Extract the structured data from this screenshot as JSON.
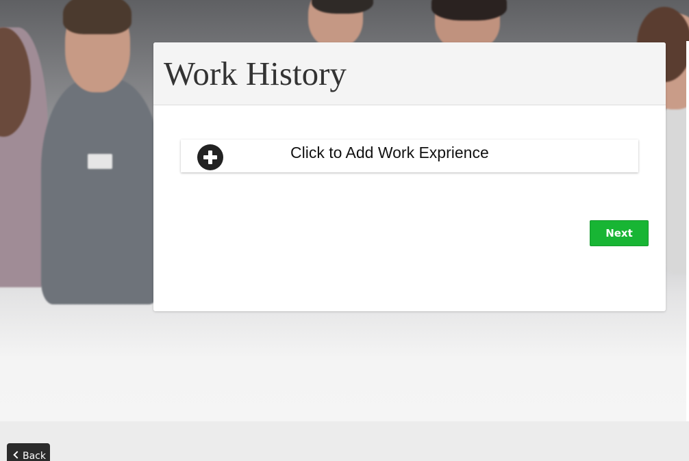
{
  "page": {
    "title": "Work History"
  },
  "work_history": {
    "add_label": "Click to Add Work Exprience",
    "add_icon": "plus-circle-icon"
  },
  "actions": {
    "next_label": "Next",
    "next_color": "#18b534",
    "back_label": "Back",
    "back_icon": "chevron-left-icon"
  }
}
